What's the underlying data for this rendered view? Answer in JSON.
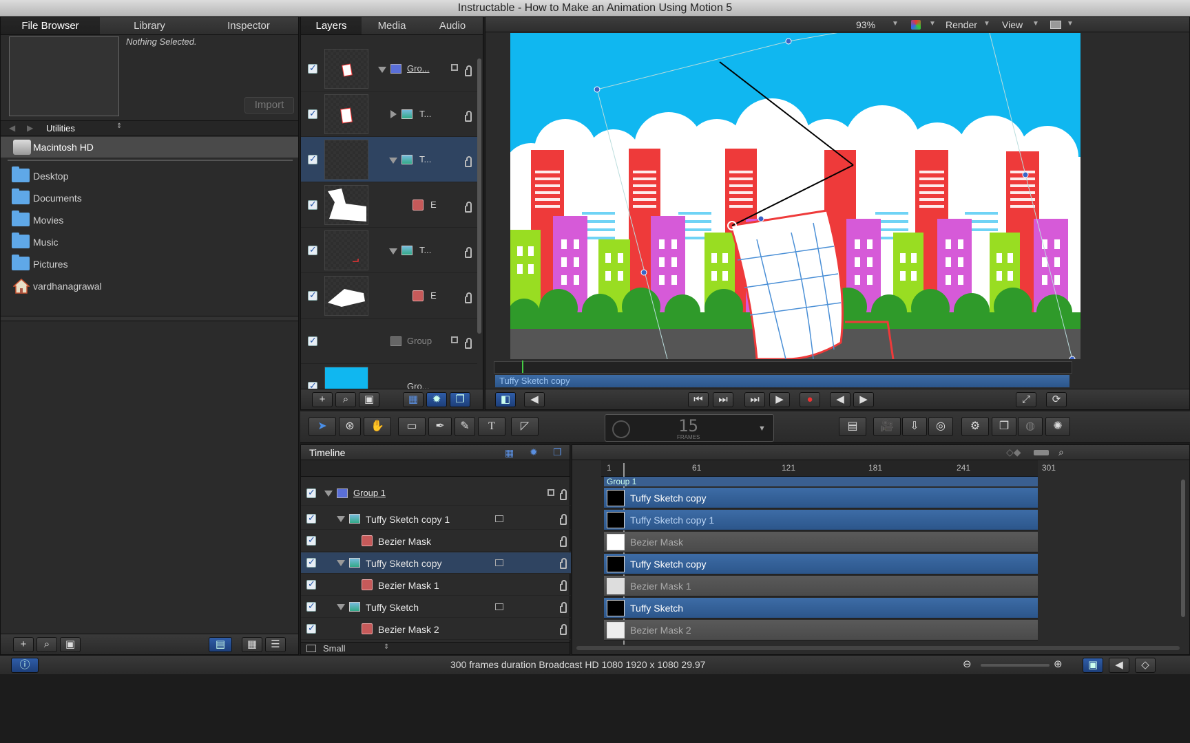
{
  "window": {
    "title": "Instructable - How to Make an Animation Using Motion 5"
  },
  "left_panel": {
    "tabs": [
      {
        "label": "File Browser"
      },
      {
        "label": "Library"
      },
      {
        "label": "Inspector"
      }
    ],
    "preview_text": "Nothing Selected.",
    "import_label": "Import",
    "location_menu": "Utilities",
    "drive": "Macintosh HD",
    "items": [
      {
        "label": "Desktop"
      },
      {
        "label": "Documents"
      },
      {
        "label": "Movies"
      },
      {
        "label": "Music"
      },
      {
        "label": "Pictures"
      },
      {
        "label": "vardhanagrawal"
      }
    ]
  },
  "layers_panel": {
    "tabs": [
      {
        "label": "Layers"
      },
      {
        "label": "Media"
      },
      {
        "label": "Audio"
      }
    ],
    "rows": [
      {
        "label": "Gro..."
      },
      {
        "label": "T..."
      },
      {
        "label": "T..."
      },
      {
        "label": "E"
      },
      {
        "label": "T..."
      },
      {
        "label": "E"
      },
      {
        "label": "Group"
      },
      {
        "label": "Gro..."
      }
    ]
  },
  "canvas": {
    "zoom": "93%",
    "render_label": "Render",
    "view_label": "View",
    "mini_timeline_label": "Tuffy Sketch copy",
    "colors": {
      "sky": "#10b7f0",
      "red": "#ee3a3a",
      "pink": "#d65ad8",
      "green": "#99dd22"
    }
  },
  "toolbar": {
    "timecode_value": "15",
    "timecode_unit": "FRAMES"
  },
  "timeline": {
    "title": "Timeline",
    "layers": [
      {
        "label": "Group 1"
      },
      {
        "label": "Tuffy Sketch copy 1"
      },
      {
        "label": "Bezier Mask"
      },
      {
        "label": "Tuffy Sketch copy"
      },
      {
        "label": "Bezier Mask 1"
      },
      {
        "label": "Tuffy Sketch"
      },
      {
        "label": "Bezier Mask 2"
      }
    ],
    "ruler": [
      "1",
      "61",
      "121",
      "181",
      "241",
      "301"
    ],
    "group_bar": "Group 1",
    "bars": [
      {
        "label": "Tuffy Sketch copy"
      },
      {
        "label": "Tuffy Sketch copy 1"
      },
      {
        "label": "Bezier Mask"
      },
      {
        "label": "Tuffy Sketch copy"
      },
      {
        "label": "Bezier Mask 1"
      },
      {
        "label": "Tuffy Sketch"
      },
      {
        "label": "Bezier Mask 2"
      }
    ],
    "size_menu": "Small"
  },
  "statusbar": {
    "text": "300 frames duration Broadcast HD 1080 1920 x 1080 29.97"
  }
}
